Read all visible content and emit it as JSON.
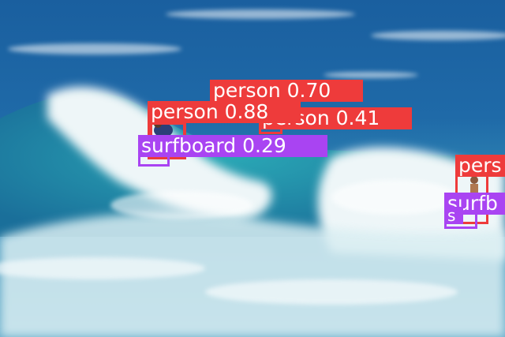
{
  "colors": {
    "person": "#ee3b3b",
    "surfboard": "#a944f2"
  },
  "detections": [
    {
      "label": "person 0.70",
      "class": "person",
      "confidence": 0.7
    },
    {
      "label": "person 0.88",
      "class": "person",
      "confidence": 0.88
    },
    {
      "label": "person 0.41",
      "class": "person",
      "confidence": 0.41
    },
    {
      "label": "surfboard 0.29",
      "class": "surfboard",
      "confidence": 0.29
    },
    {
      "label": "pers",
      "class": "person"
    },
    {
      "label": "surfb",
      "class": "surfboard"
    },
    {
      "label": "s",
      "class": "surfboard"
    }
  ]
}
